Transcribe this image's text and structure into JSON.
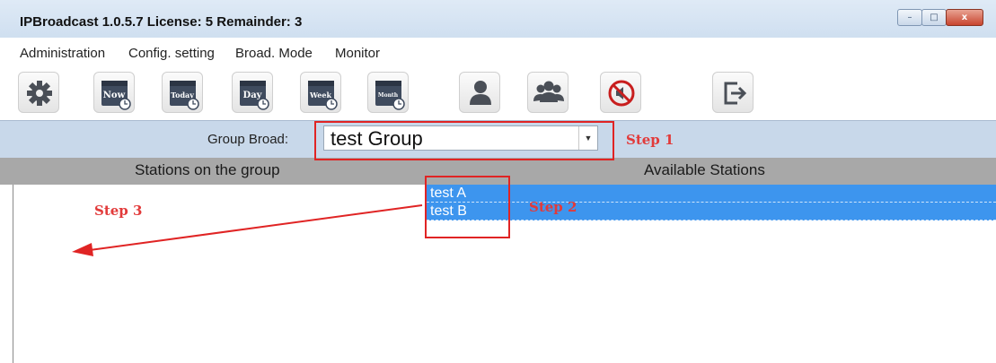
{
  "window": {
    "title": "IPBroadcast 1.0.5.7 License: 5 Remainder: 3",
    "controls": {
      "minimize": "–",
      "maximize": "□",
      "close": "x"
    }
  },
  "menu": {
    "items": [
      "Administration",
      "Config. setting",
      "Broad. Mode",
      "Monitor"
    ]
  },
  "toolbar": {
    "buttons": [
      {
        "icon": "settings-gear-icon"
      },
      {
        "icon": "calendar-clock-icon",
        "label": "Now"
      },
      {
        "icon": "calendar-clock-icon",
        "label": "Today"
      },
      {
        "icon": "calendar-clock-icon",
        "label": "Day"
      },
      {
        "icon": "calendar-clock-icon",
        "label": "Week"
      },
      {
        "icon": "calendar-clock-icon",
        "label": "Month"
      },
      {
        "icon": "user-icon"
      },
      {
        "icon": "users-group-icon"
      },
      {
        "icon": "mute-icon"
      },
      {
        "icon": "exit-icon"
      }
    ]
  },
  "group_broad": {
    "label": "Group Broad:",
    "selected": "test Group"
  },
  "headers": {
    "left": "Stations on the group",
    "right": "Available Stations"
  },
  "available_stations": [
    "test A",
    "test B"
  ],
  "stations_on_group": [],
  "annotations": {
    "step1": "Step 1",
    "step2": "Step 2",
    "step3": "Step 3",
    "color": "#e02424"
  },
  "colors": {
    "selection": "#3d95ee",
    "group_bar": "#c8d8ea",
    "header_bar": "#a8a8a8"
  }
}
